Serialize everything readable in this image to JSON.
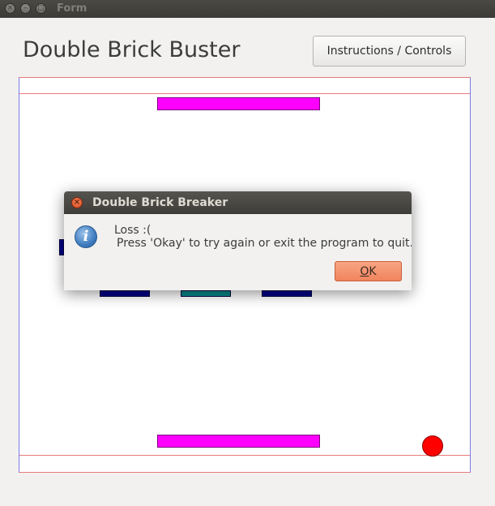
{
  "window": {
    "title": "Form",
    "controls": [
      "close",
      "minimize",
      "maximize"
    ]
  },
  "app": {
    "title": "Double Brick Buster",
    "instructions_button": "Instructions / Controls"
  },
  "game": {
    "colors": {
      "paddle": "#ff00ff",
      "brick_blue": "#00008b",
      "brick_teal": "#008b8b",
      "ball": "#ff0000"
    }
  },
  "dialog": {
    "title": "Double Brick Breaker",
    "message_line1": "Loss :(",
    "message_line2": "Press 'Okay' to try again or exit the program to quit.",
    "ok_button_mnemonic": "O",
    "ok_button_rest": "K",
    "icon": "info-icon"
  }
}
